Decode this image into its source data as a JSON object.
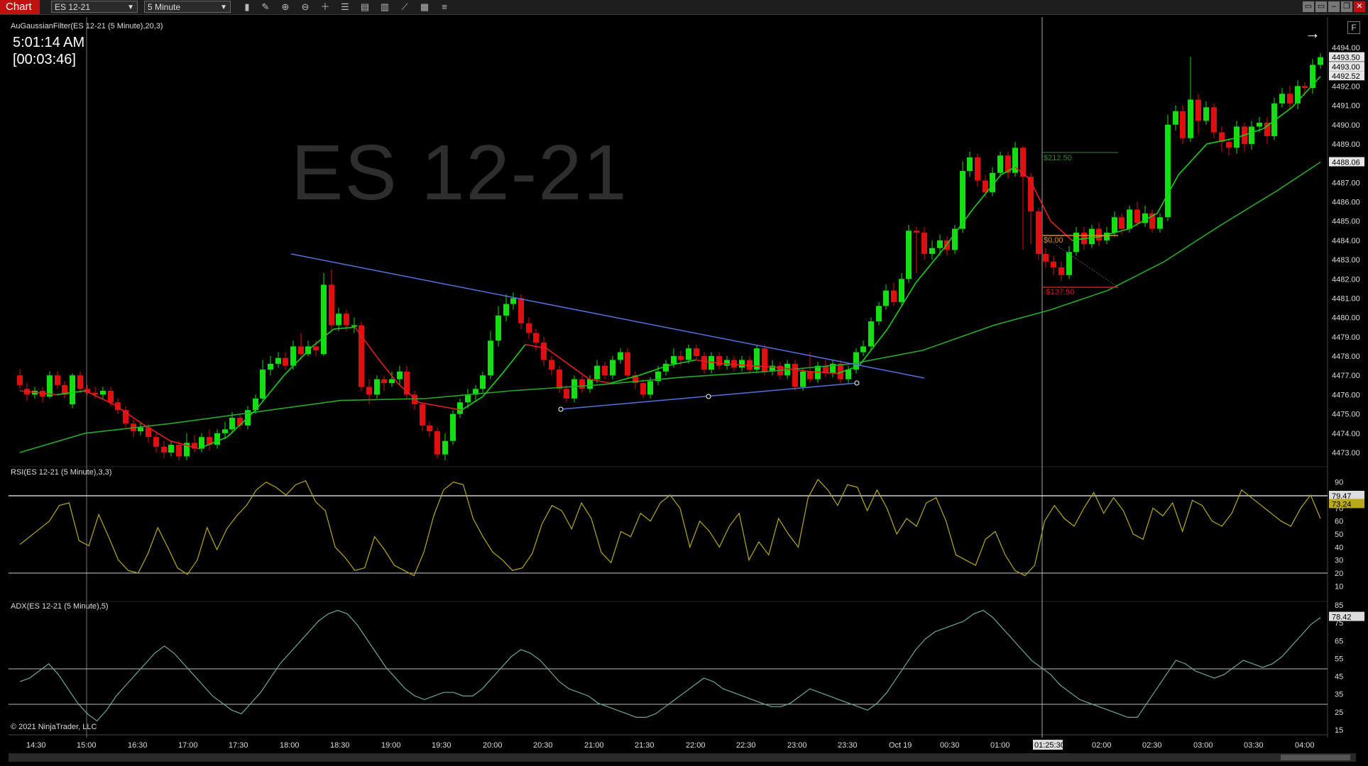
{
  "toolbar": {
    "app_tab": "Chart",
    "instrument": "ES 12-21",
    "interval": "5 Minute"
  },
  "clock": {
    "time": "5:01:14 AM",
    "countdown": "[00:03:46]"
  },
  "watermark": "ES 12-21",
  "panels": {
    "price_title": "AuGaussianFilter(ES 12-21 (5 Minute),20,3)",
    "rsi_title": "RSI(ES 12-21 (5 Minute),3,3)",
    "adx_title": "ADX(ES 12-21 (5 Minute),5)"
  },
  "copyright": "© 2021 NinjaTrader, LLC",
  "f_button": "F",
  "price_axis": {
    "ticks": [
      "4494.00",
      "4492.00",
      "4491.00",
      "4490.00",
      "4489.00",
      "4488.00",
      "4487.00",
      "4486.00",
      "4485.00",
      "4484.00",
      "4483.00",
      "4482.00",
      "4481.00",
      "4480.00",
      "4479.00",
      "4478.00",
      "4477.00",
      "4476.00",
      "4475.00",
      "4474.00",
      "4473.00"
    ],
    "markers": [
      {
        "text": "4493.50",
        "value": 4493.5,
        "color": "#e6e6e6"
      },
      {
        "text": "4493.00",
        "value": 4493.0,
        "color": "#e6e6e6"
      },
      {
        "text": "4492.52",
        "value": 4492.52,
        "color": "#e6e6e6"
      },
      {
        "text": "4488.06",
        "value": 4488.06,
        "color": "#e6e6e6"
      }
    ]
  },
  "rsi_axis": {
    "ticks": [
      "90",
      "70",
      "60",
      "50",
      "40",
      "30",
      "20",
      "10"
    ],
    "markers": [
      "79.47",
      "73.24"
    ]
  },
  "adx_axis": {
    "ticks": [
      "85",
      "75",
      "65",
      "55",
      "45",
      "35",
      "25",
      "15"
    ],
    "markers": [
      "78.42"
    ]
  },
  "time_axis": {
    "labels": [
      "14:30",
      "15:00",
      "16:30",
      "17:00",
      "17:30",
      "18:00",
      "18:30",
      "19:00",
      "19:30",
      "20:00",
      "20:30",
      "21:00",
      "21:30",
      "22:00",
      "22:30",
      "23:00",
      "23:30",
      "Oct 19",
      "00:30",
      "01:00",
      "01:25:30",
      "02:00",
      "02:30",
      "03:00",
      "03:30",
      "04:00"
    ],
    "cursor_label": "01:25:30"
  },
  "position_tags": {
    "profit": "$212.50",
    "entry": "$0.00",
    "loss": "-$137.50"
  },
  "colors": {
    "up": "#12e012",
    "down": "#e01010",
    "gaussian_up": "#18d018",
    "gaussian_down": "#e02020",
    "slow_ma": "#2aa82a",
    "rsi": "#b8a81c",
    "adx": "#6aa89a",
    "trendline": "#5570e0"
  }
}
